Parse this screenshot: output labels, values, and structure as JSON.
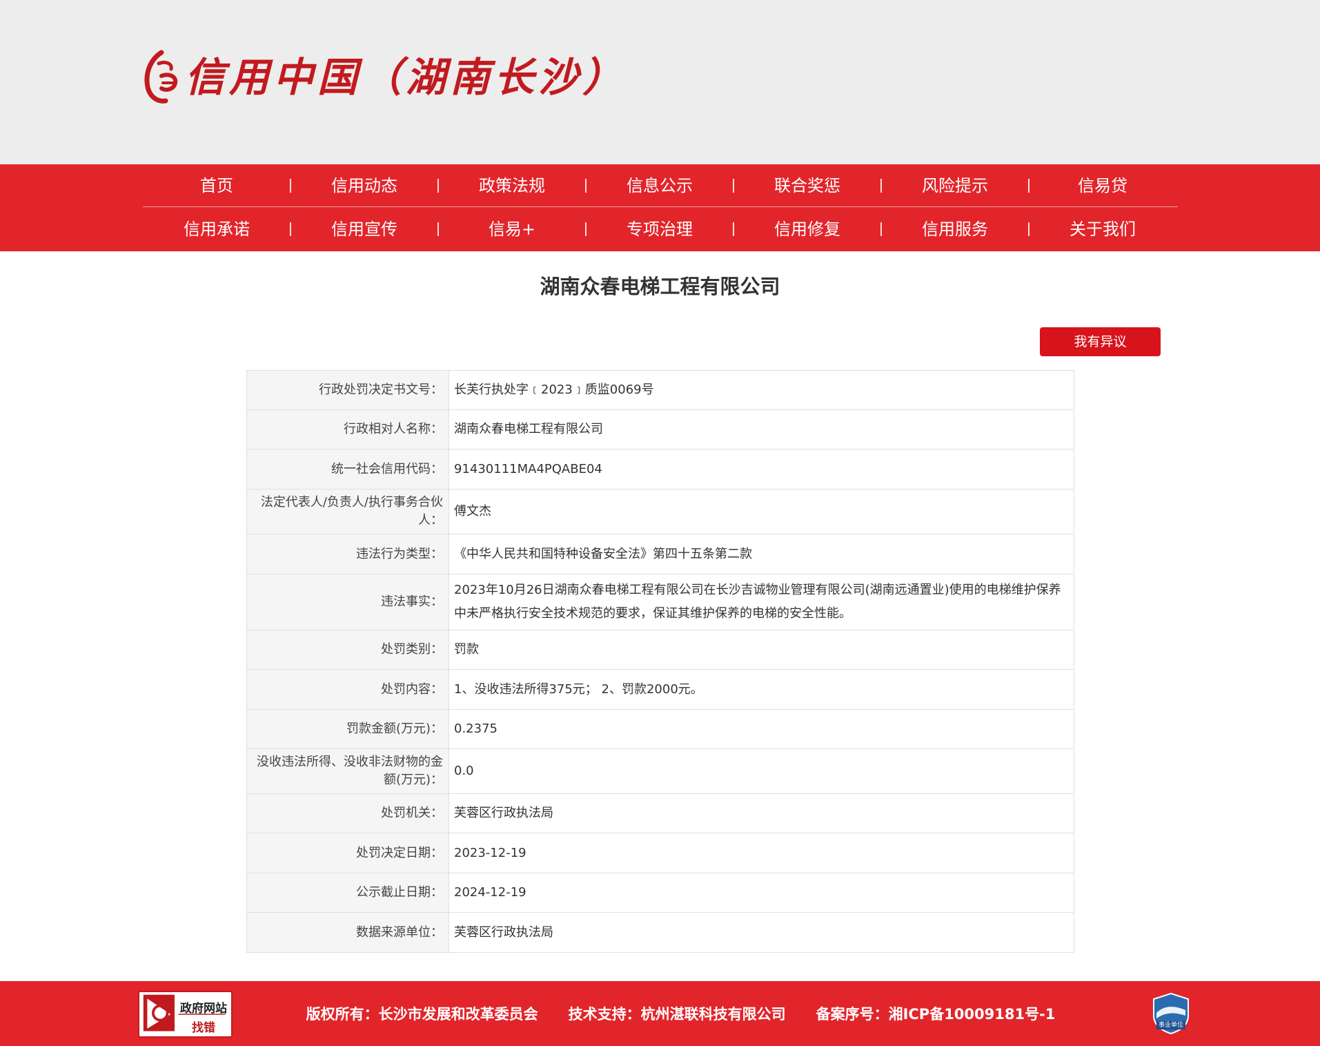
{
  "header": {
    "logo_text": "信用中国（湖南长沙）"
  },
  "nav": {
    "row1": [
      "首页",
      "信用动态",
      "政策法规",
      "信息公示",
      "联合奖惩",
      "风险提示",
      "信易贷"
    ],
    "row2": [
      "信用承诺",
      "信用宣传",
      "信易+",
      "专项治理",
      "信用修复",
      "信用服务",
      "关于我们"
    ]
  },
  "page": {
    "title": "湖南众春电梯工程有限公司",
    "objection_button": "我有异议"
  },
  "record": {
    "rows": [
      {
        "label": "行政处罚决定书文号：",
        "value": "长芙行执处字﹝2023﹞质监0069号"
      },
      {
        "label": "行政相对人名称：",
        "value": "湖南众春电梯工程有限公司"
      },
      {
        "label": "统一社会信用代码：",
        "value": "91430111MA4PQABE04"
      },
      {
        "label": "法定代表人/负责人/执行事务合伙人：",
        "value": "傅文杰"
      },
      {
        "label": "违法行为类型：",
        "value": "《中华人民共和国特种设备安全法》第四十五条第二款"
      },
      {
        "label": "违法事实：",
        "value": "2023年10月26日湖南众春电梯工程有限公司在长沙吉诚物业管理有限公司(湖南远通置业)使用的电梯维护保养中未严格执行安全技术规范的要求，保证其维护保养的电梯的安全性能。"
      },
      {
        "label": "处罚类别：",
        "value": "罚款"
      },
      {
        "label": "处罚内容：",
        "value": "1、没收违法所得375元； 2、罚款2000元。"
      },
      {
        "label": "罚款金额(万元)：",
        "value": "0.2375"
      },
      {
        "label": "没收违法所得、没收非法财物的金额(万元)：",
        "value": "0.0"
      },
      {
        "label": "处罚机关：",
        "value": "芙蓉区行政执法局"
      },
      {
        "label": "处罚决定日期：",
        "value": "2023-12-19"
      },
      {
        "label": "公示截止日期：",
        "value": "2024-12-19"
      },
      {
        "label": "数据来源单位：",
        "value": "芙蓉区行政执法局"
      }
    ]
  },
  "footer": {
    "gov_badge_title": "政府网站",
    "gov_badge_sub": "找错",
    "copyright": "版权所有：长沙市发展和改革委员会",
    "tech_support": "技术支持：杭州湛联科技有限公司",
    "icp": "备案序号：湘ICP备10009181号-1",
    "shield_label": "事业单位"
  },
  "colors": {
    "brand_red": "#e2252b",
    "button_red": "#d7141b",
    "header_bg": "#ededed",
    "logo_red": "#c21a1f"
  },
  "icons": {
    "logo": "credit-china-logo-icon",
    "gov_badge": "magnifier-icon",
    "shield": "institution-shield-icon"
  }
}
